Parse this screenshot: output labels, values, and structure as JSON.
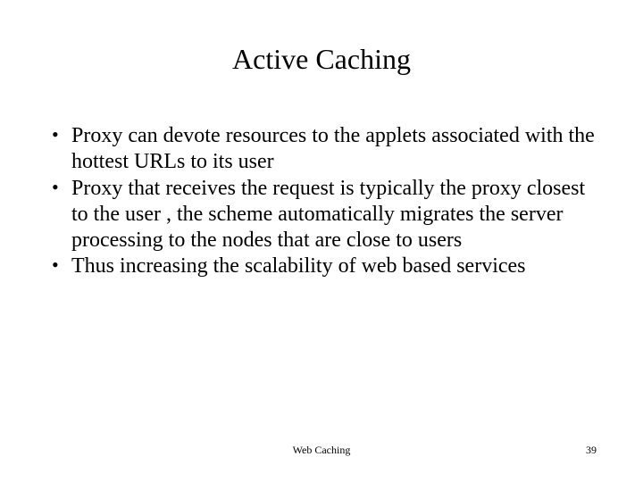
{
  "slide": {
    "title": "Active Caching",
    "bullets": [
      "Proxy can devote resources to the applets associated with the hottest URLs to its user",
      "Proxy that receives the request is typically the proxy closest to the user , the scheme automatically migrates the server processing to the nodes  that are close to users",
      "Thus increasing the scalability of web based services"
    ],
    "footer": {
      "center": "Web  Caching",
      "page": "39"
    }
  }
}
